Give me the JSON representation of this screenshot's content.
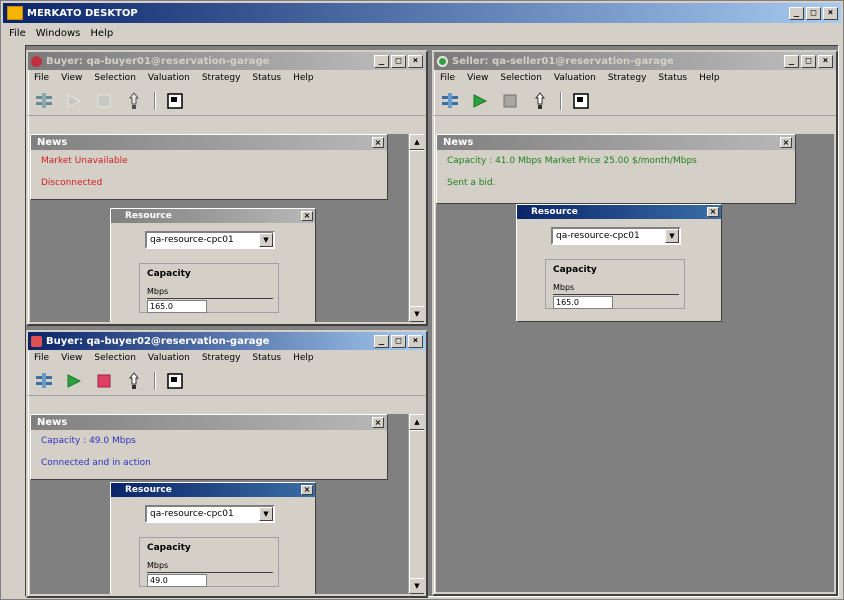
{
  "app": {
    "title": "MERKATO DESKTOP",
    "menu": [
      "File",
      "Windows",
      "Help"
    ],
    "controls": [
      "_",
      "□",
      "×"
    ]
  },
  "internal_menu": [
    "File",
    "View",
    "Selection",
    "Valuation",
    "Strategy",
    "Status",
    "Help"
  ],
  "windows": {
    "top_left": {
      "title": "Buyer: qa-buyer01@reservation-garage",
      "news": {
        "title": "News",
        "lines": [
          "Market Unavailable",
          "Disconnected"
        ],
        "color": "#d02020"
      },
      "resource": {
        "title": "Resource",
        "selected": "qa-resource-cpc01",
        "capacity_label": "Capacity",
        "unit": "Mbps",
        "value": "165.0"
      }
    },
    "bottom_left": {
      "title": "Buyer: qa-buyer02@reservation-garage",
      "news": {
        "title": "News",
        "lines": [
          "Capacity : 49.0 Mbps",
          "Connected and in action"
        ],
        "color": "#3030c0"
      },
      "resource": {
        "title": "Resource",
        "selected": "qa-resource-cpc01",
        "capacity_label": "Capacity",
        "unit": "Mbps",
        "value": "49.0"
      }
    },
    "right": {
      "title": "Seller: qa-seller01@reservation-garage",
      "news": {
        "title": "News",
        "lines": [
          "Capacity : 41.0 Mbps  Market Price 25.00 $/month/Mbps",
          "Sent a bid."
        ],
        "color": "#208020"
      },
      "resource": {
        "title": "Resource",
        "selected": "qa-resource-cpc01",
        "capacity_label": "Capacity",
        "unit": "Mbps",
        "value": "165.0"
      }
    }
  },
  "colors": {
    "title_active": "#0a246a",
    "desktop": "#808080",
    "play": "#2aa43a",
    "stop_active": "#e04060"
  }
}
